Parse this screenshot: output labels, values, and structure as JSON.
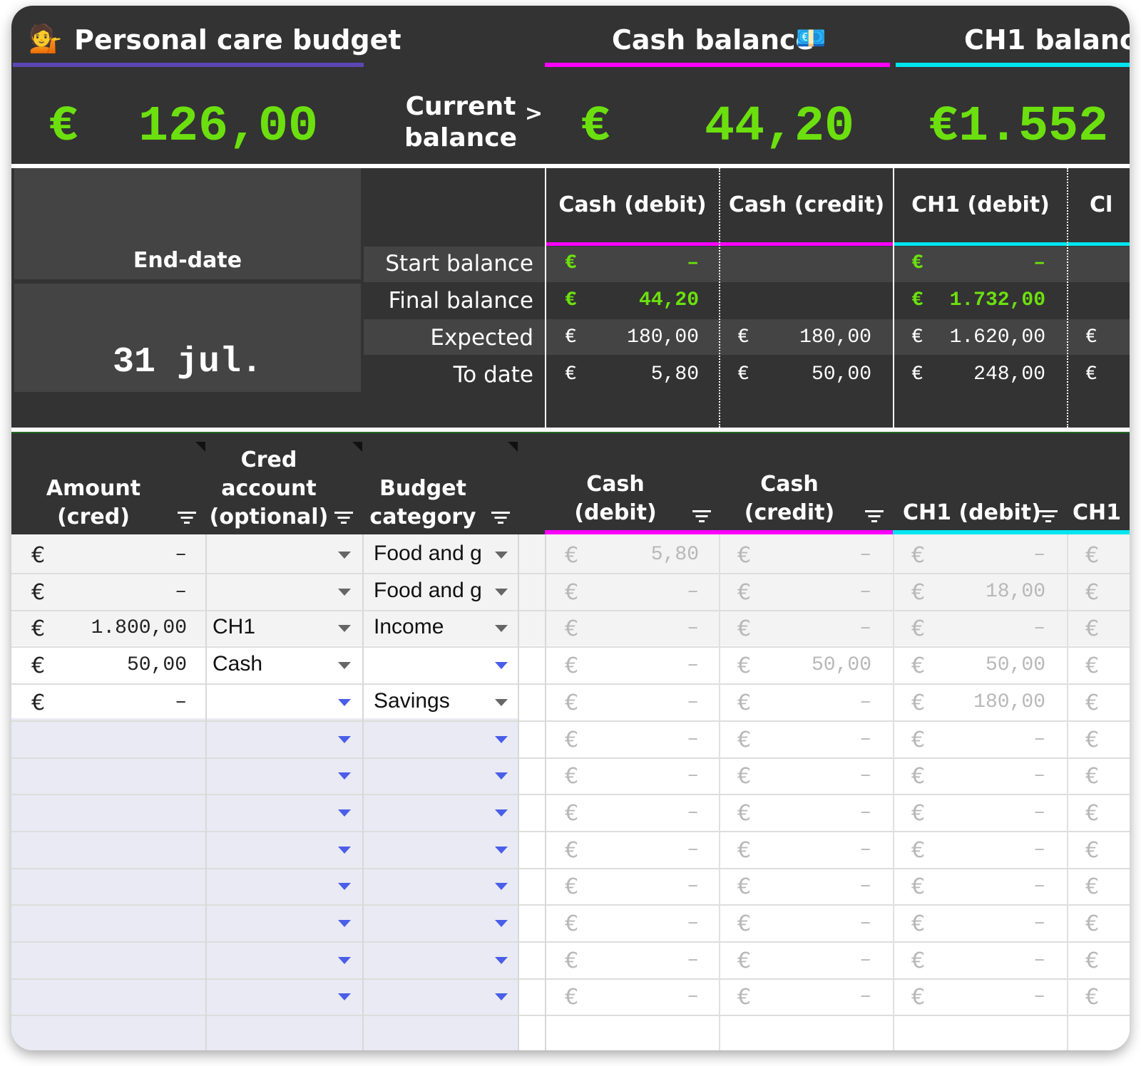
{
  "title": {
    "emoji": "💁",
    "text": "Personal care budget"
  },
  "balances": {
    "cash_title": "Cash balance",
    "cash_emoji": "💶",
    "ch1_title": "CH1 balanc",
    "total": "€  126,00",
    "current_label_1": "Current",
    "current_label_2": "balance",
    "current_arrow": ">",
    "cash_value_symbol": "€",
    "cash_value": "44,20",
    "ch1_value": "€1.552"
  },
  "enddate": {
    "label": "End-date",
    "value": "31 jul."
  },
  "summary": {
    "col_headers": [
      "Cash (debit)",
      "Cash (credit)",
      "CH1 (debit)",
      "Cl"
    ],
    "rows": [
      {
        "label": "Start balance",
        "cells": [
          {
            "sym": "€",
            "val": "–"
          },
          {
            "sym": "",
            "val": ""
          },
          {
            "sym": "€",
            "val": "–"
          },
          {
            "sym": "",
            "val": ""
          }
        ]
      },
      {
        "label": "Final balance",
        "cells": [
          {
            "sym": "€",
            "val": "44,20"
          },
          {
            "sym": "",
            "val": ""
          },
          {
            "sym": "€",
            "val": "1.732,00"
          },
          {
            "sym": "",
            "val": ""
          }
        ]
      },
      {
        "label": "Expected",
        "cells": [
          {
            "sym": "€",
            "val": "180,00"
          },
          {
            "sym": "€",
            "val": "180,00"
          },
          {
            "sym": "€",
            "val": "1.620,00"
          },
          {
            "sym": "€",
            "val": ""
          }
        ]
      },
      {
        "label": "To date",
        "cells": [
          {
            "sym": "€",
            "val": "5,80"
          },
          {
            "sym": "€",
            "val": "50,00"
          },
          {
            "sym": "€",
            "val": "248,00"
          },
          {
            "sym": "€",
            "val": ""
          }
        ]
      }
    ]
  },
  "table": {
    "headers": {
      "amount": [
        "Amount",
        "(cred)"
      ],
      "cred_account": [
        "Cred",
        "account",
        "(optional)"
      ],
      "budget_category": [
        "Budget",
        "category"
      ],
      "cash_debit": [
        "Cash",
        "(debit)"
      ],
      "cash_credit": [
        "Cash",
        "(credit)"
      ],
      "ch1_debit": "CH1 (debit)",
      "ch1_more": "CH1"
    },
    "rows": [
      {
        "amount_sym": "€",
        "amount": "–",
        "account": "",
        "category": "Food and g",
        "cash_debit": "5,80",
        "cash_credit": "–",
        "ch1_debit": "–"
      },
      {
        "amount_sym": "€",
        "amount": "–",
        "account": "",
        "category": "Food and g",
        "cash_debit": "–",
        "cash_credit": "–",
        "ch1_debit": "18,00"
      },
      {
        "amount_sym": "€",
        "amount": "1.800,00",
        "account": "CH1",
        "category": "Income",
        "cash_debit": "–",
        "cash_credit": "–",
        "ch1_debit": "–"
      },
      {
        "amount_sym": "€",
        "amount": "50,00",
        "account": "Cash",
        "category": "",
        "cash_debit": "–",
        "cash_credit": "50,00",
        "ch1_debit": "50,00"
      },
      {
        "amount_sym": "€",
        "amount": "–",
        "account": "",
        "category": "Savings",
        "cash_debit": "–",
        "cash_credit": "–",
        "ch1_debit": "180,00"
      },
      {
        "amount_sym": "",
        "amount": "",
        "account": "",
        "category": "",
        "cash_debit": "–",
        "cash_credit": "–",
        "ch1_debit": "–"
      },
      {
        "amount_sym": "",
        "amount": "",
        "account": "",
        "category": "",
        "cash_debit": "–",
        "cash_credit": "–",
        "ch1_debit": "–"
      },
      {
        "amount_sym": "",
        "amount": "",
        "account": "",
        "category": "",
        "cash_debit": "–",
        "cash_credit": "–",
        "ch1_debit": "–"
      },
      {
        "amount_sym": "",
        "amount": "",
        "account": "",
        "category": "",
        "cash_debit": "–",
        "cash_credit": "–",
        "ch1_debit": "–"
      },
      {
        "amount_sym": "",
        "amount": "",
        "account": "",
        "category": "",
        "cash_debit": "–",
        "cash_credit": "–",
        "ch1_debit": "–"
      },
      {
        "amount_sym": "",
        "amount": "",
        "account": "",
        "category": "",
        "cash_debit": "–",
        "cash_credit": "–",
        "ch1_debit": "–"
      },
      {
        "amount_sym": "",
        "amount": "",
        "account": "",
        "category": "",
        "cash_debit": "–",
        "cash_credit": "–",
        "ch1_debit": "–"
      },
      {
        "amount_sym": "",
        "amount": "",
        "account": "",
        "category": "",
        "cash_debit": "–",
        "cash_credit": "–",
        "ch1_debit": "–"
      }
    ]
  },
  "colors": {
    "header_bg": "#333333",
    "accent_purple": "#5b47b3",
    "accent_magenta": "#ff00ff",
    "accent_cyan": "#00e5f0",
    "value_green": "#6ce00e",
    "dropdown_blue": "#4a5ee8"
  }
}
